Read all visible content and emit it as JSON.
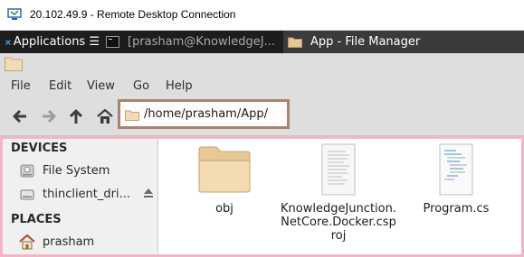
{
  "rdp": {
    "title": "20.102.49.9 - Remote Desktop Connection"
  },
  "panel": {
    "applications_label": "Applications ☰",
    "task_terminal": "[prasham@KnowledgeJ...",
    "task_file_manager": "App - File Manager"
  },
  "menu": {
    "file": "File",
    "edit": "Edit",
    "view": "View",
    "go": "Go",
    "help": "Help"
  },
  "address": {
    "path": "/home/prasham/App/"
  },
  "sidebar": {
    "devices_heading": "DEVICES",
    "places_heading": "PLACES",
    "devices": [
      {
        "label": "File System",
        "icon": "drive-icon"
      },
      {
        "label": "thinclient_dri...",
        "icon": "drive-icon"
      }
    ],
    "places": [
      {
        "label": "prasham",
        "icon": "home-icon"
      }
    ]
  },
  "files": [
    {
      "name": "obj",
      "icon": "folder-icon"
    },
    {
      "name": "KnowledgeJunction.\nNetCore.Docker.csp\nroj",
      "icon": "document-icon"
    },
    {
      "name": "Program.cs",
      "icon": "code-file-icon"
    }
  ],
  "colors": {
    "panel": "#1d1d1d",
    "address_highlight": "#a9836c",
    "content_highlight": "#f2b6c6"
  }
}
